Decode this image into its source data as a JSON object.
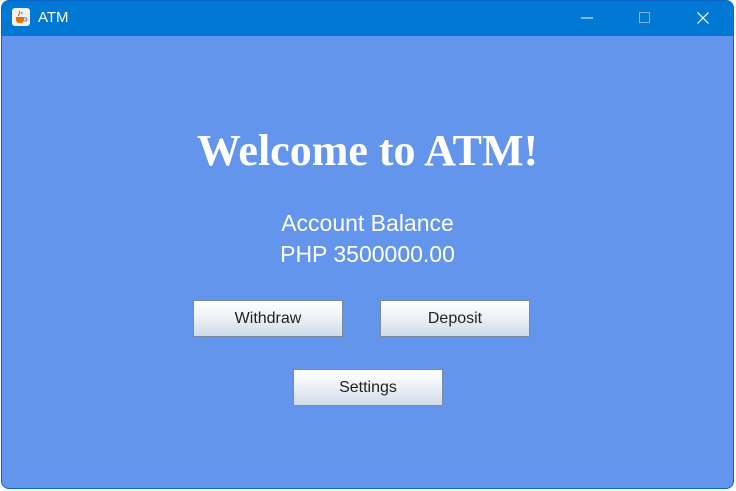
{
  "window": {
    "title": "ATM",
    "controls": [
      "minimize-icon",
      "maximize-icon",
      "close-icon"
    ],
    "app_icon": "java-cup-icon"
  },
  "main": {
    "welcome": "Welcome to ATM!",
    "balance_label": "Account Balance",
    "balance_value": "PHP 3500000.00"
  },
  "buttons": {
    "withdraw": "Withdraw",
    "deposit": "Deposit",
    "settings": "Settings"
  },
  "colors": {
    "background": "#6495ed",
    "titlebar": "#0078d4",
    "text": "#ffffff"
  }
}
